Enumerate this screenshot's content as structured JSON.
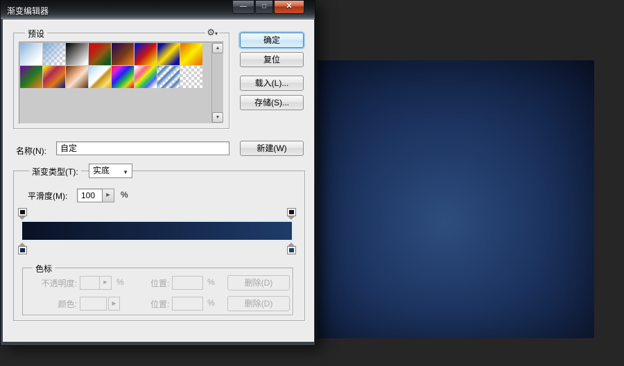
{
  "window": {
    "title": "渐变编辑器",
    "minimize_glyph": "—",
    "maximize_glyph": "□",
    "close_glyph": "✕"
  },
  "presets": {
    "label": "预设",
    "gear_glyph": "⚙",
    "gear_caret": "▾",
    "scroll_up_glyph": "▲",
    "scroll_down_glyph": "▼",
    "items": [
      {
        "name": "foreground-to-background",
        "background": "linear-gradient(135deg,#86add8 0%,#c6dcf0 40%,#ffffff 80%)"
      },
      {
        "name": "foreground-to-transparent",
        "background": "linear-gradient(135deg,#7fa8d4 0%,rgba(150,190,228,0.55) 45%,rgba(255,255,255,0) 80%)",
        "transparent": true
      },
      {
        "name": "black-to-white",
        "background": "linear-gradient(135deg,#0a0a0a 5%,#f8f8f8 90%)"
      },
      {
        "name": "red-to-green",
        "background": "linear-gradient(135deg,#c81414 25%,#8c5a10 55%,#0f5a1e 85%)"
      },
      {
        "name": "violet-to-orange",
        "background": "linear-gradient(135deg,#2e1052 10%,#7a3a18 55%,#d87818 90%)"
      },
      {
        "name": "blue-red-yellow",
        "background": "linear-gradient(135deg,#1414b4 10%,#c81414 50%,#f0d800 90%)"
      },
      {
        "name": "blue-yellow-blue",
        "background": "linear-gradient(135deg,#1010a0 15%,#ffe000 50%,#1010a0 85%)"
      },
      {
        "name": "orange-yellow-orange",
        "background": "linear-gradient(135deg,#e88000 10%,#ffee00 50%,#e88000 90%)"
      },
      {
        "name": "violet-green-orange",
        "background": "linear-gradient(135deg,#6a1090 5%,#207a20 50%,#e08018 95%)"
      },
      {
        "name": "yellow-violet-orange-blue",
        "background": "linear-gradient(135deg,#ffe000 5%,#b02858 35%,#e07818 65%,#182878 95%)"
      },
      {
        "name": "copper",
        "background": "linear-gradient(135deg,#7a3c14 5%,#e8b088 40%,#f8e0c8 55%,#5c2e10 100%)"
      },
      {
        "name": "chrome-gold",
        "background": "linear-gradient(135deg,#a8d0f0 0%,#e8f4fc 30%,#ffffff 48%,#c89018 56%,#f8e070 80%,#d8a020 100%)"
      },
      {
        "name": "spectrum",
        "background": "linear-gradient(135deg,#ff2020 0%,#e020e0 20%,#2020ff 42%,#20b840 62%,#d8d820 78%,#ff2020 95%)"
      },
      {
        "name": "transparent-rainbow",
        "background": "linear-gradient(135deg,rgba(255,255,255,0.95) 5%,rgba(255,80,120,0.9) 30%,rgba(255,230,0,0.9) 45%,rgba(40,200,60,0.9) 60%,rgba(60,90,255,0.9) 75%,rgba(255,255,255,0.9) 92%)",
        "transparent": true
      },
      {
        "name": "transparent-stripes",
        "background": "repeating-linear-gradient(135deg,#4a78b8 0px,#8fb4da 3px,rgba(255,255,255,0.15) 5px,rgba(255,255,255,0.15) 7px,#4a78b8 9px)",
        "transparent": true
      },
      {
        "name": "transparent-sample",
        "background": "none",
        "transparent": true
      }
    ]
  },
  "action_buttons": {
    "ok": "确定",
    "reset": "复位",
    "load": "载入(L)...",
    "save": "存储(S)..."
  },
  "name_row": {
    "label": "名称(N):",
    "value": "自定",
    "new_button": "新建(W)"
  },
  "gradient_section": {
    "type_label": "渐变类型(T):",
    "type_value": "实底",
    "type_caret": "▼",
    "smooth_label": "平滑度(M):",
    "smooth_value": "100",
    "smooth_caret": "▶",
    "percent": "%",
    "bar_left_color": "#0a1124",
    "bar_right_color": "#1e3c6a",
    "opacity_stops": [
      {
        "position": 0
      },
      {
        "position": 100
      }
    ],
    "color_stops": [
      {
        "position": 0,
        "color": "#14274a"
      },
      {
        "position": 100,
        "color": "#1e3c6a"
      }
    ]
  },
  "stops_section": {
    "label": "色标",
    "opacity_label": "不透明度:",
    "opacity_caret": "▶",
    "color_label": "颜色:",
    "color_picker_caret": "▶",
    "position_label": "位置:",
    "percent": "%",
    "delete_label": "删除(D)"
  },
  "canvas": {
    "center_color": "#2e4d7e",
    "mid_color": "#1c3460",
    "edge_color": "#0b142e"
  }
}
